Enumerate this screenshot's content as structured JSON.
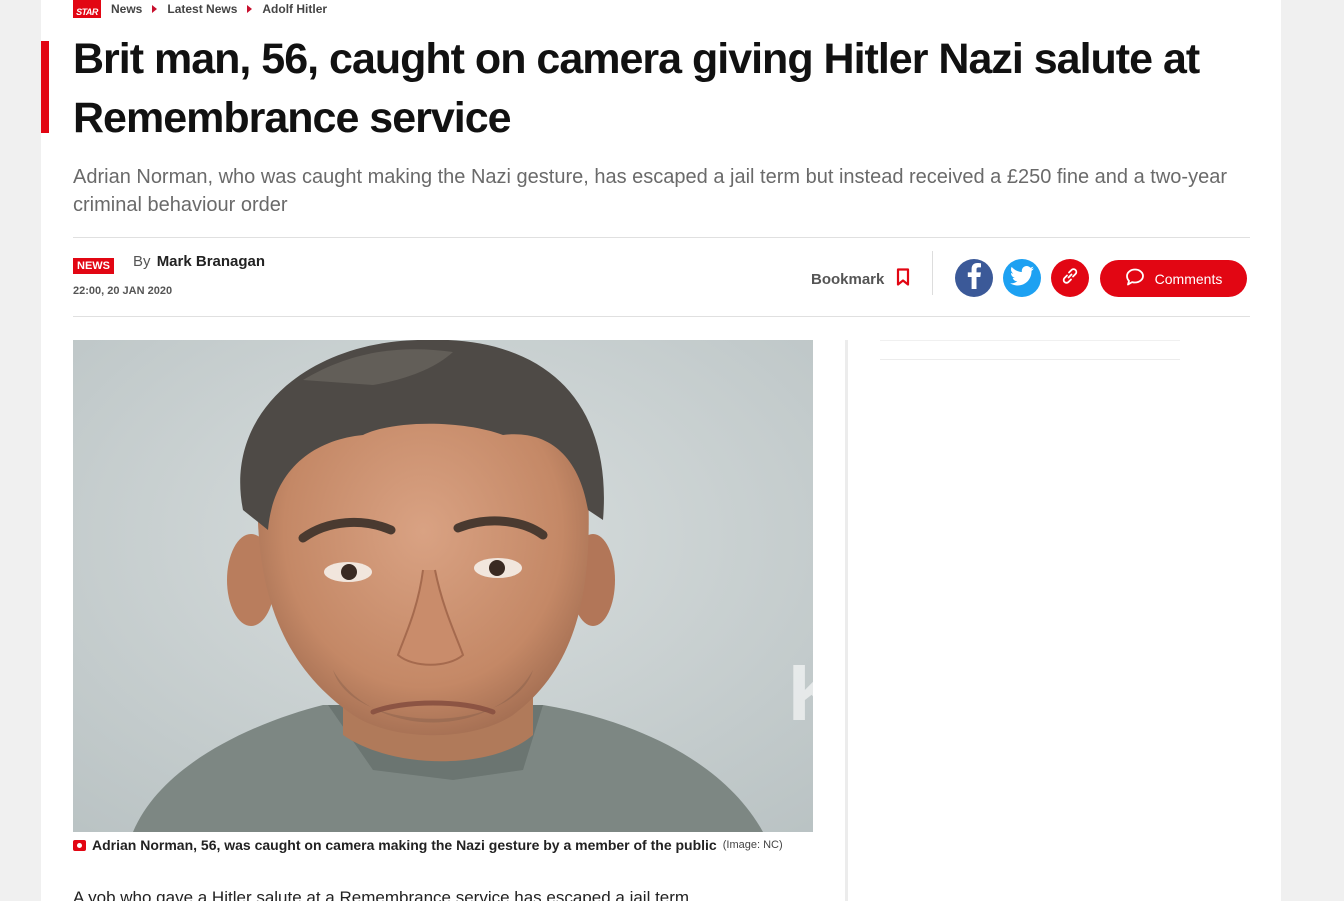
{
  "breadcrumb": {
    "logo_text": "STAR",
    "items": [
      "News",
      "Latest News",
      "Adolf Hitler"
    ]
  },
  "article": {
    "headline": "Brit man, 56, caught on camera giving Hitler Nazi salute at Remembrance service",
    "standfirst": "Adrian Norman, who was caught making the Nazi gesture, has escaped a jail term but instead received a £250 fine and a two-year criminal behaviour order",
    "tag": "NEWS",
    "by_label": "By",
    "author": "Mark Branagan",
    "timestamp": "22:00, 20 JAN 2020",
    "image_caption": "Adrian Norman, 56, was caught on camera making the Nazi gesture by a member of the public",
    "image_credit": "(Image: NC)",
    "body_first_line": "A yob who gave a Hitler salute at a Remembrance service has escaped a jail term"
  },
  "actions": {
    "bookmark_label": "Bookmark",
    "comments_label": "Comments"
  },
  "colors": {
    "accent": "#e20613",
    "facebook": "#3b5998",
    "twitter": "#1da1f2"
  },
  "icons": [
    "camera-icon",
    "bookmark-icon",
    "facebook-icon",
    "twitter-icon",
    "link-icon",
    "comment-icon"
  ]
}
